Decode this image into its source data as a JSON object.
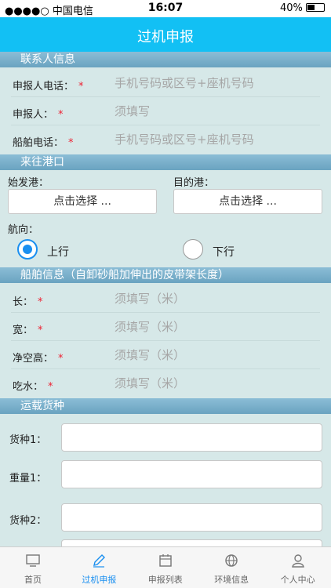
{
  "status": {
    "carrier": "●●●●○ 中国电信",
    "time": "16:07",
    "battery": "40%",
    "battery_level": 0.4
  },
  "nav": {
    "title": "过机申报"
  },
  "contact": {
    "header": "联系人信息",
    "phone_label": "申报人电话：",
    "phone_placeholder": "手机号码或区号+座机号码",
    "name_label": "申报人：",
    "name_placeholder": "须填写",
    "ship_phone_label": "船舶电话：",
    "ship_phone_placeholder": "手机号码或区号+座机号码",
    "required_mark": "*"
  },
  "ports": {
    "header": "来往港口",
    "origin_label": "始发港：",
    "dest_label": "目的港：",
    "select_text": "点击选择 ...",
    "direction_label": "航向：",
    "up_label": "上行",
    "down_label": "下行"
  },
  "ship": {
    "header": "船舶信息（自卸砂船加伸出的皮带架长度）",
    "length_label": "长：",
    "width_label": "宽：",
    "clearance_label": "净空高：",
    "draft_label": "吃水：",
    "placeholder": "须填写（米）"
  },
  "cargo": {
    "header": "运载货种",
    "type1_label": "货种1：",
    "weight1_label": "重量1：",
    "type2_label": "货种2："
  },
  "tabs": [
    {
      "label": "首页",
      "icon": "monitor-icon"
    },
    {
      "label": "过机申报",
      "icon": "pencil-icon"
    },
    {
      "label": "申报列表",
      "icon": "calendar-icon"
    },
    {
      "label": "环境信息",
      "icon": "globe-icon"
    },
    {
      "label": "个人中心",
      "icon": "person-icon"
    }
  ],
  "colors": {
    "nav": "#12c0f4",
    "accent": "#1a8ff0",
    "section": "#7fb3cc",
    "background": "#d6e8e8"
  }
}
